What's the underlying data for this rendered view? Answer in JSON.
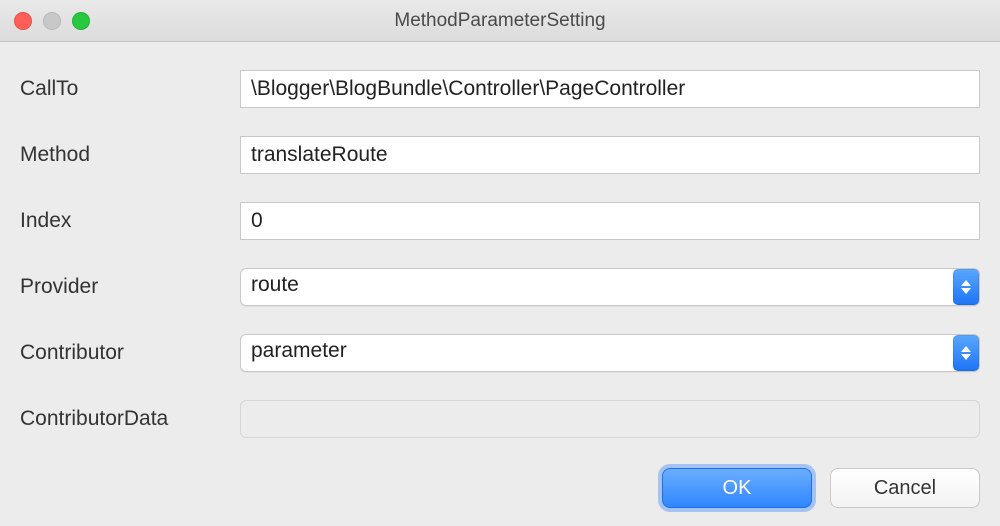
{
  "window": {
    "title": "MethodParameterSetting"
  },
  "form": {
    "callTo": {
      "label": "CallTo",
      "value": "\\Blogger\\BlogBundle\\Controller\\PageController"
    },
    "method": {
      "label": "Method",
      "value": "translateRoute"
    },
    "index": {
      "label": "Index",
      "value": "0"
    },
    "provider": {
      "label": "Provider",
      "value": "route"
    },
    "contributor": {
      "label": "Contributor",
      "value": "parameter"
    },
    "contributorData": {
      "label": "ContributorData",
      "value": ""
    }
  },
  "buttons": {
    "ok": "OK",
    "cancel": "Cancel"
  }
}
